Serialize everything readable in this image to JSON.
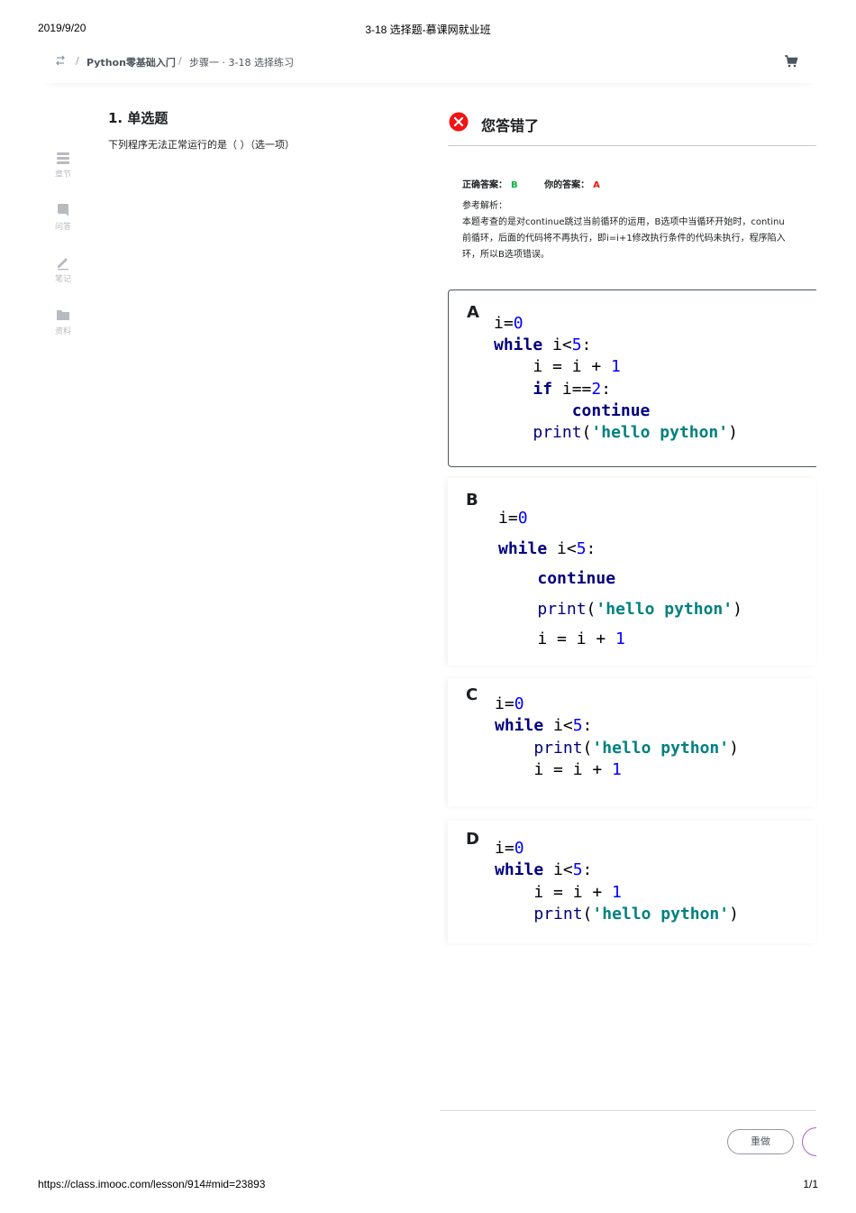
{
  "print_header": {
    "date": "2019/9/20",
    "title": "3-18 选择题-慕课网就业班"
  },
  "breadcrumb": {
    "sep": "/",
    "course": "Python零基础入门",
    "step": "步骤一 · 3-18 选择练习"
  },
  "sidebar": {
    "items": [
      {
        "label": "章节",
        "icon": "chapter-icon"
      },
      {
        "label": "问答",
        "icon": "qa-icon"
      },
      {
        "label": "笔记",
        "icon": "note-icon"
      },
      {
        "label": "资料",
        "icon": "folder-icon"
      }
    ]
  },
  "question": {
    "title": "1. 单选题",
    "text": "下列程序无法正常运行的是（ ）（选一项）"
  },
  "result": {
    "status": "您答错了",
    "correct_label": "正确答案：",
    "correct_value": "B",
    "yours_label": "你的答案：",
    "yours_value": "A",
    "analysis_title": "参考解析：",
    "analysis_lines": [
      "本题考查的是对continue跳过当前循环的运用，B选项中当循环开始时，continu",
      "前循环，后面的代码将不再执行，即i=i+1修改执行条件的代码未执行，程序陷入",
      "环，所以B选项错误。"
    ]
  },
  "options": [
    {
      "letter": "A",
      "code": [
        "i=0",
        "while i<5:",
        "    i = i + 1",
        "    if i==2:",
        "        continue",
        "    print('hello python')"
      ]
    },
    {
      "letter": "B",
      "code": [
        "i=0",
        "while i<5:",
        "    continue",
        "    print('hello python')",
        "    i = i + 1"
      ]
    },
    {
      "letter": "C",
      "code": [
        "i=0",
        "while i<5:",
        "    print('hello python')",
        "    i = i + 1"
      ]
    },
    {
      "letter": "D",
      "code": [
        "i=0",
        "while i<5:",
        "    i = i + 1",
        "    print('hello python')"
      ]
    }
  ],
  "actions": {
    "redo": "重做"
  },
  "print_footer": {
    "url": "https://class.imooc.com/lesson/914#mid=23893",
    "pages": "1/1"
  },
  "colors": {
    "correct": "#00b43c",
    "wrong": "#f01414",
    "keyword": "#000080",
    "number": "#0000ff",
    "string": "#008080"
  }
}
